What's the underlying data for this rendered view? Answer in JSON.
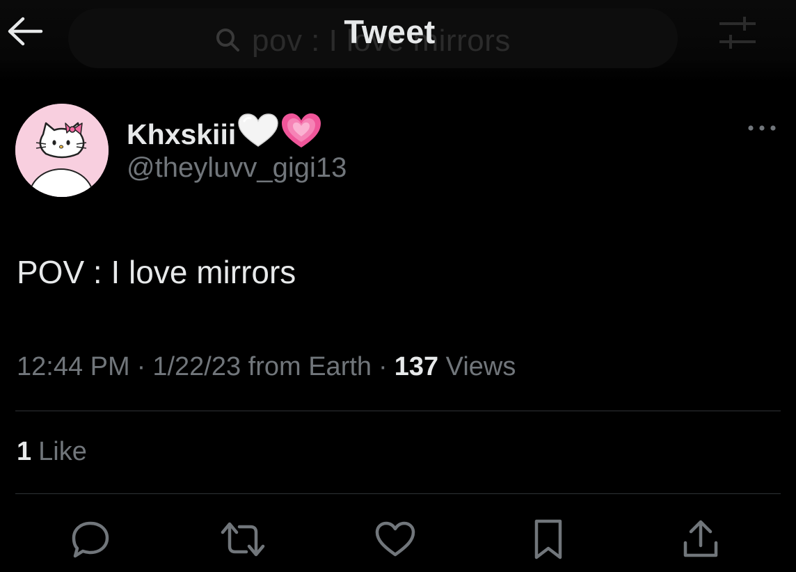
{
  "header": {
    "title": "Tweet",
    "background_search_text": "pov : I love mirrors"
  },
  "author": {
    "display_name": "Khxskiii",
    "name_emojis": [
      "white-heart-emoji",
      "growing-heart-emoji"
    ],
    "handle": "@theyluvv_gigi13",
    "avatar": "hello-kitty-avatar"
  },
  "tweet": {
    "text": "POV : I love mirrors",
    "time": "12:44 PM",
    "separator": "·",
    "date_source": "1/22/23 from Earth",
    "views_count": "137",
    "views_label": "Views"
  },
  "stats": {
    "likes_count": "1",
    "likes_label": "Like"
  },
  "actions": [
    "reply-icon",
    "retweet-icon",
    "like-icon",
    "bookmark-icon",
    "share-icon"
  ],
  "colors": {
    "background": "#000000",
    "text_primary": "#e7e9ea",
    "text_secondary": "#71767b",
    "divider": "#2f3336",
    "pink_heart": "#f0569a"
  }
}
